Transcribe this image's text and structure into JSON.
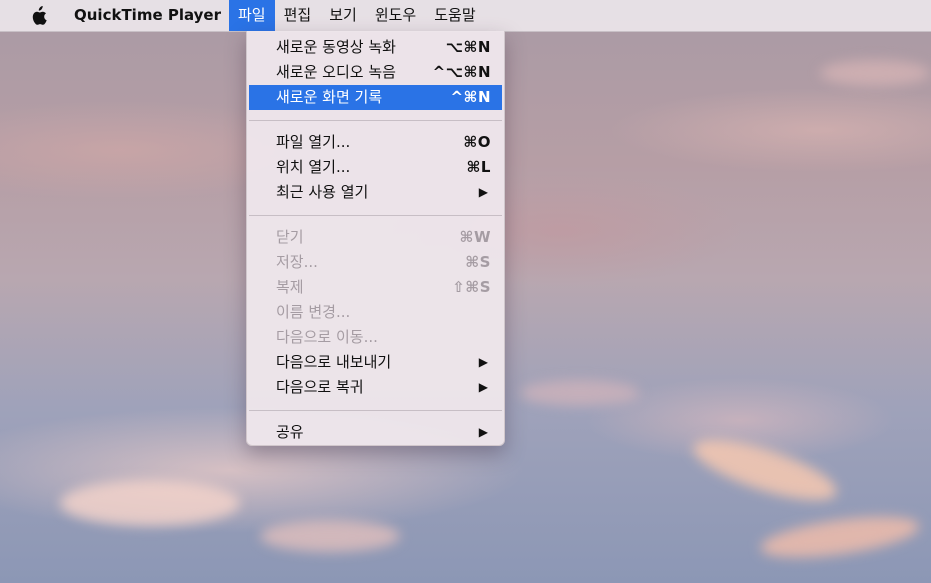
{
  "menubar": {
    "apple_icon": "apple-logo",
    "app_name": "QuickTime Player",
    "items": [
      "파일",
      "편집",
      "보기",
      "윈도우",
      "도움말"
    ],
    "active_index": 0
  },
  "colors": {
    "highlight": "#2a73e6",
    "disabled_text": "#a59ca3"
  },
  "file_menu": {
    "group1": [
      {
        "label": "새로운 동영상 녹화",
        "shortcut": "⌥⌘N"
      },
      {
        "label": "새로운 오디오 녹음",
        "shortcut": "^⌥⌘N"
      },
      {
        "label": "새로운 화면 기록",
        "shortcut": "^⌘N",
        "highlighted": true
      }
    ],
    "group2": [
      {
        "label": "파일 열기...",
        "shortcut": "⌘O"
      },
      {
        "label": "위치 열기...",
        "shortcut": "⌘L"
      },
      {
        "label": "최근 사용 열기",
        "submenu_icon": "▶"
      }
    ],
    "group3": [
      {
        "label": "닫기",
        "shortcut": "⌘W",
        "disabled": true
      },
      {
        "label": "저장...",
        "shortcut": "⌘S",
        "disabled": true
      },
      {
        "label": "복제",
        "shortcut": "⇧⌘S",
        "disabled": true
      },
      {
        "label": "이름 변경...",
        "disabled": true
      },
      {
        "label": "다음으로 이동...",
        "disabled": true
      },
      {
        "label": "다음으로 내보내기",
        "submenu_icon": "▶"
      },
      {
        "label": "다음으로 복귀",
        "submenu_icon": "▶"
      }
    ],
    "group4": [
      {
        "label": "공유",
        "submenu_icon": "▶"
      }
    ]
  }
}
